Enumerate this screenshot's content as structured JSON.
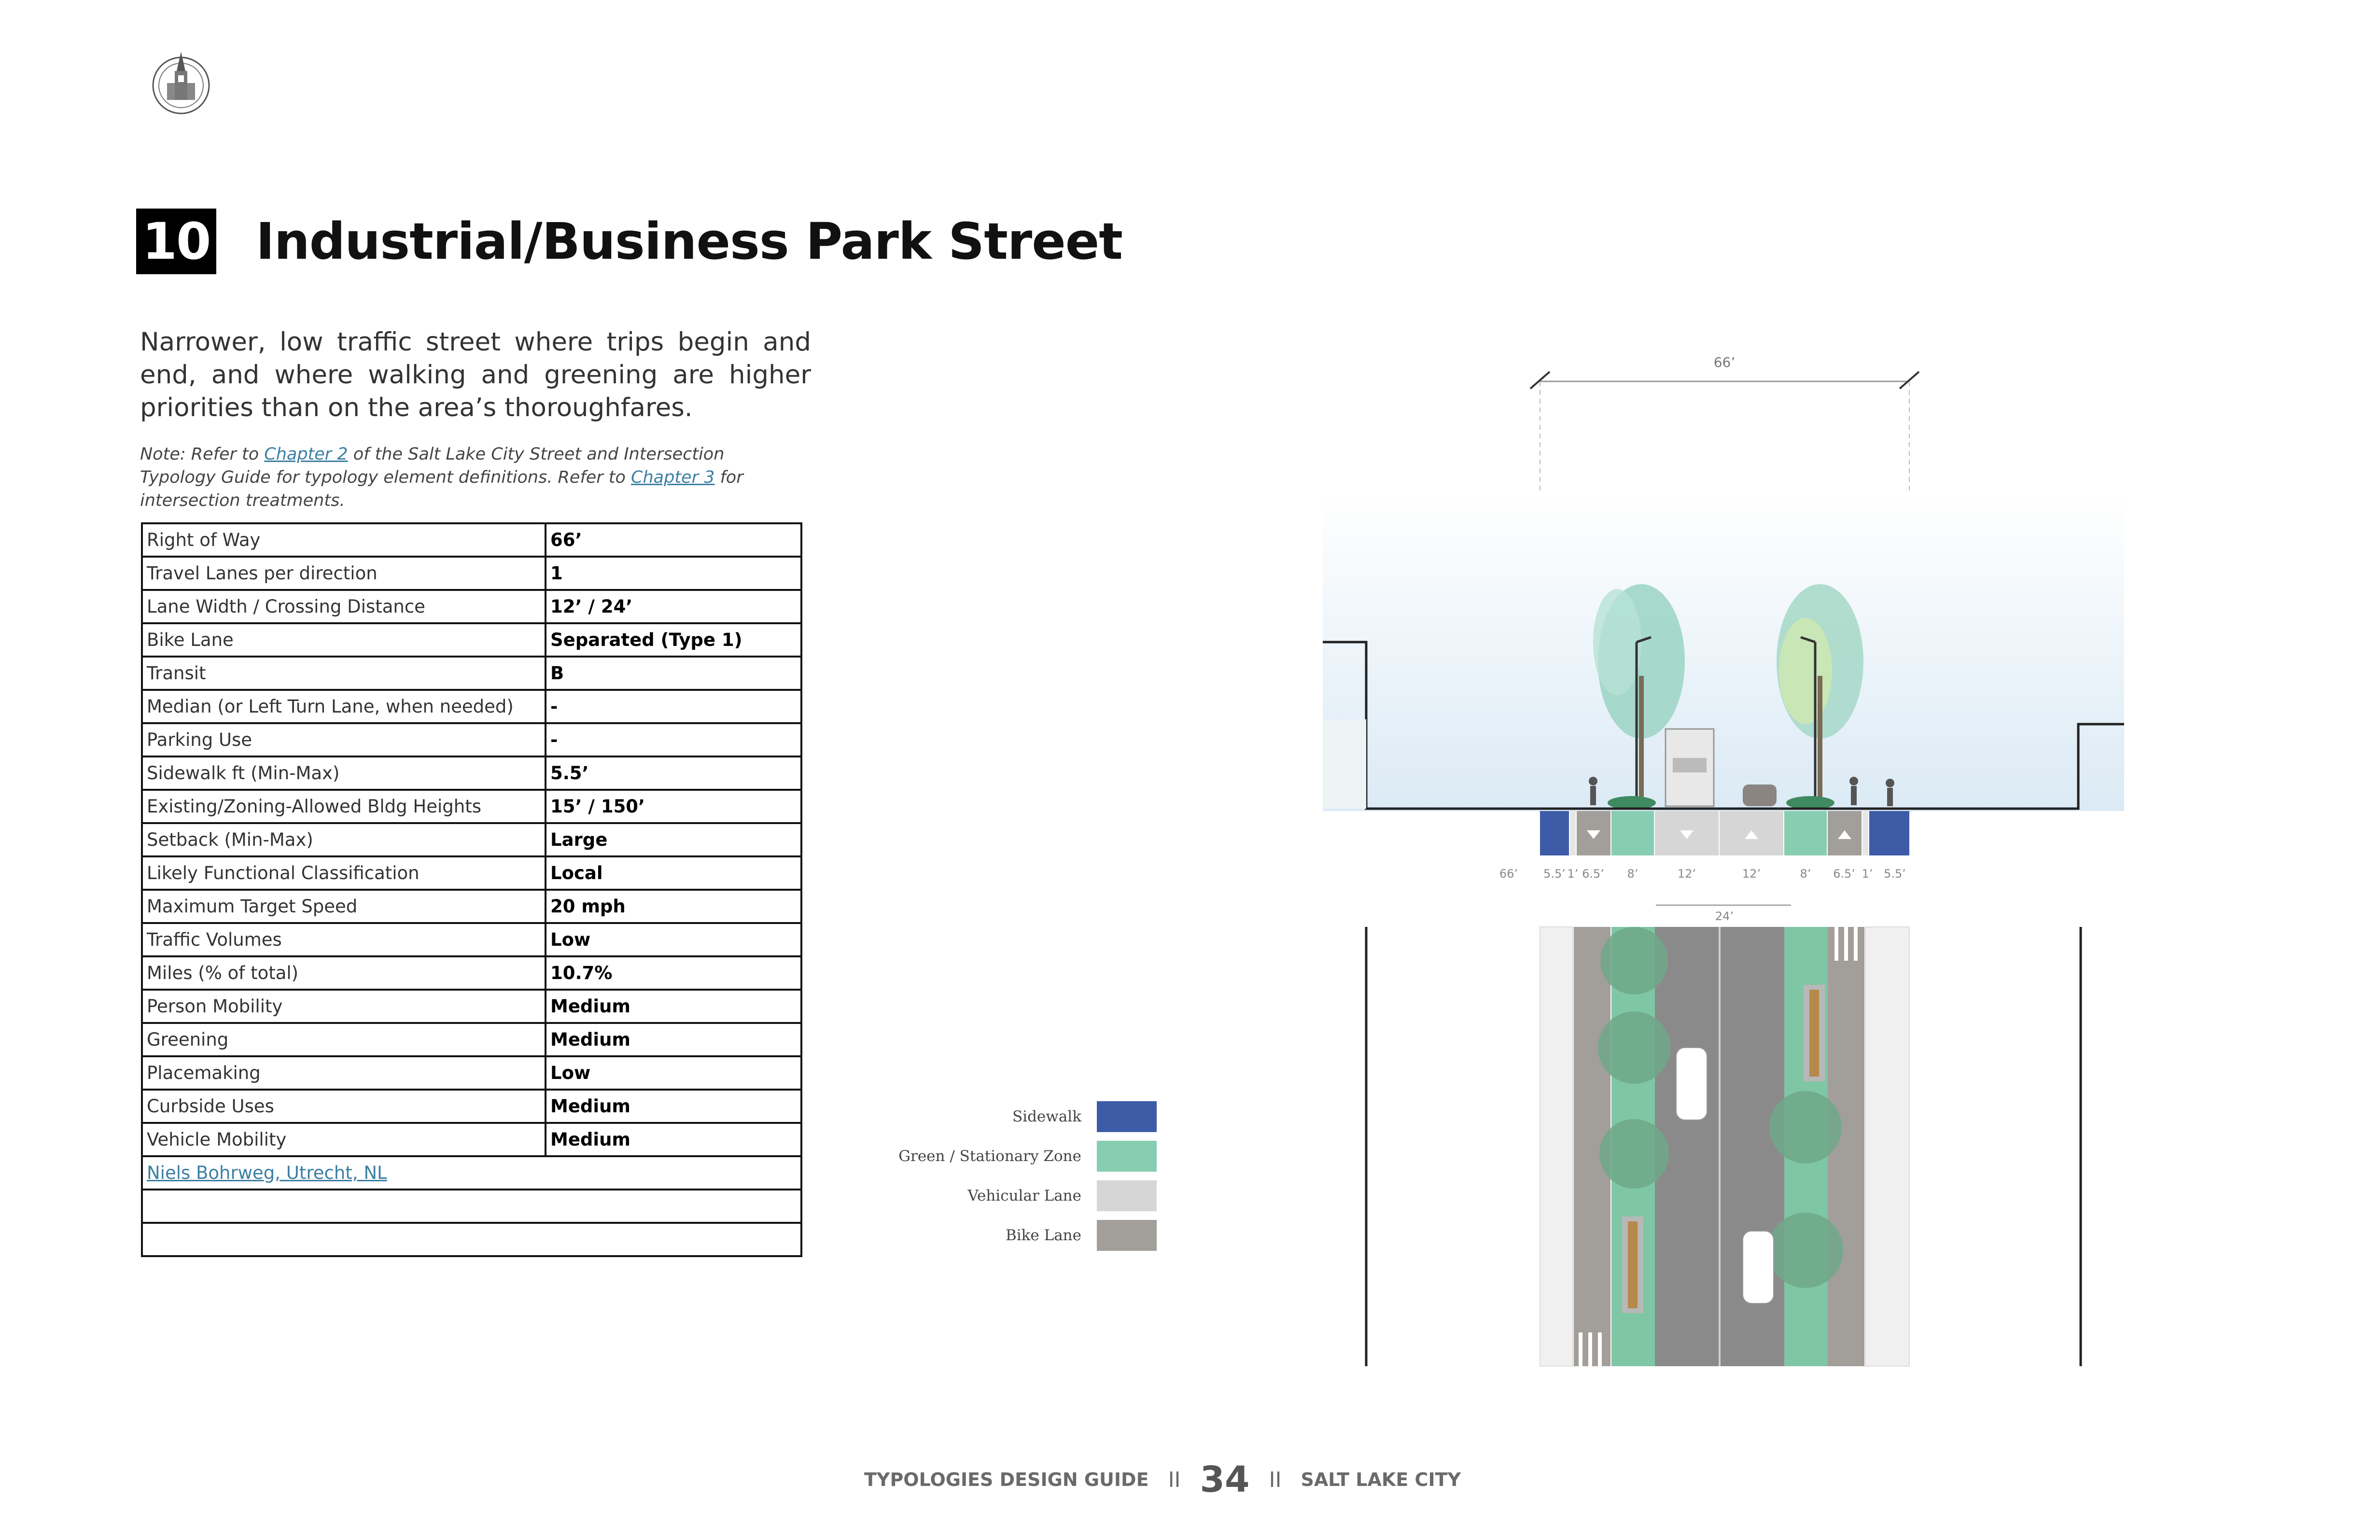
{
  "header": {
    "number": "10",
    "title": "Industrial/Business Park Street"
  },
  "intro": "Narrower, low traffic street where trips begin and end, and where walking and greening are higher priorities than on the area’s thoroughfares.",
  "note": {
    "prefix": "Note: Refer to ",
    "chapter2": "Chapter 2",
    "middle": " of the Salt Lake City Street and Intersection Typology Guide for typology element definitions. Refer to ",
    "chapter3": "Chapter 3",
    "suffix": " for intersection treatments."
  },
  "table": {
    "rows": [
      {
        "k": "Right of Way",
        "v": "66’"
      },
      {
        "k": "Travel Lanes per direction",
        "v": "1"
      },
      {
        "k": "Lane Width / Crossing Distance",
        "v": "12’ / 24’"
      },
      {
        "k": "Bike Lane",
        "v": "Separated (Type 1)"
      },
      {
        "k": "Transit",
        "v": "B"
      },
      {
        "k": "Median (or Left Turn Lane, when needed)",
        "v": "-"
      },
      {
        "k": "Parking Use",
        "v": "-"
      },
      {
        "k": "Sidewalk ft (Min-Max)",
        "v": "5.5’"
      },
      {
        "k": "Existing/Zoning-Allowed Bldg Heights",
        "v": "15’ / 150’"
      },
      {
        "k": "Setback (Min-Max)",
        "v": "Large"
      },
      {
        "k": "Likely Functional Classification",
        "v": "Local"
      },
      {
        "k": "Maximum Target Speed",
        "v": "20 mph"
      },
      {
        "k": "Traffic Volumes",
        "v": "Low"
      },
      {
        "k": "Miles (% of total)",
        "v": "10.7%"
      },
      {
        "k": "Person Mobility",
        "v": "Medium"
      },
      {
        "k": "Greening",
        "v": "Medium"
      },
      {
        "k": "Placemaking",
        "v": "Low"
      },
      {
        "k": "Curbside Uses",
        "v": "Medium"
      },
      {
        "k": "Vehicle Mobility",
        "v": "Medium"
      }
    ],
    "link": "Niels Bohrweg, Utrecht, NL"
  },
  "legend": [
    {
      "label": "Sidewalk",
      "color": "#3e5ba8"
    },
    {
      "label": "Green / Stationary Zone",
      "color": "#86cdb2"
    },
    {
      "label": "Vehicular Lane",
      "color": "#d6d6d6"
    },
    {
      "label": "Bike Lane",
      "color": "#a29e99"
    }
  ],
  "diagram": {
    "row_width": "66’",
    "crossing_width": "24’",
    "dims": [
      "66’",
      "5.5’",
      "1’",
      "6.5’",
      "8’",
      "12’",
      "12’",
      "8’",
      "6.5’",
      "1’",
      "5.5’"
    ]
  },
  "footer": {
    "left": "TYPOLOGIES DESIGN GUIDE",
    "sep": "II",
    "page": "34",
    "right": "SALT LAKE CITY"
  },
  "colors": {
    "sidewalk": "#3e5ba8",
    "green": "#86cdb2",
    "vehicular": "#d6d6d6",
    "bike": "#a29e99",
    "link": "#3b7fa3"
  }
}
